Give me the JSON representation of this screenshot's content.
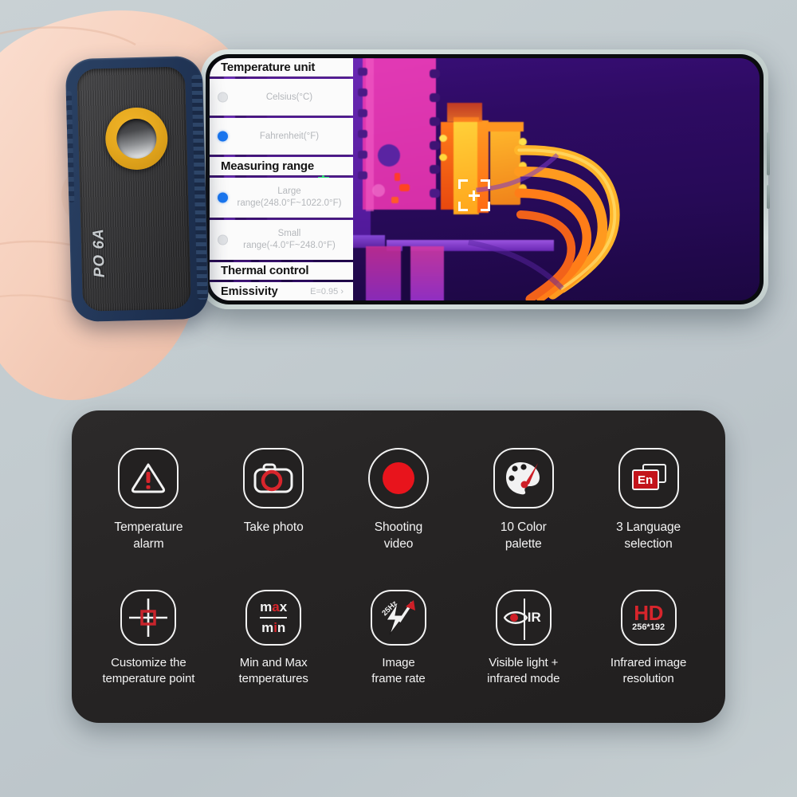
{
  "background_color": "#c5ced1",
  "device": {
    "name": "thermal-imaging-camera-module",
    "brand_text": "PO 6A",
    "case_color": "#24395a",
    "lens_ring_color": "#e5a81e"
  },
  "phone": {
    "name": "smartphone-with-thermal-app",
    "frame_color": "#c8d4d2"
  },
  "settings": {
    "rows": [
      {
        "type": "header",
        "label": "Temperature unit"
      },
      {
        "type": "option",
        "label": "Celsius(°C)",
        "selected": false
      },
      {
        "type": "option",
        "label": "Fahrenheit(°F)",
        "selected": true
      },
      {
        "type": "header",
        "label": "Measuring range"
      },
      {
        "type": "option",
        "label": "Large range(248.0°F~1022.0°F)",
        "selected": true
      },
      {
        "type": "option",
        "label": "Small range(-4.0°F~248.0°F)",
        "selected": false
      },
      {
        "type": "header",
        "label": "Thermal control"
      },
      {
        "type": "keyvalue",
        "label": "Emissivity",
        "value": "E=0.95 ›"
      }
    ],
    "selected_radio_color": "#1976f0",
    "unselected_radio_color": "#e2e4e7"
  },
  "thermal_view": {
    "reticles": [
      {
        "name": "cold-spot-reticle",
        "color": "#2fe07a"
      },
      {
        "name": "hot-spot-reticle",
        "color": "#ffffff"
      }
    ]
  },
  "features": {
    "panel_color": "#262424",
    "row1": [
      {
        "icon": "temperature-alarm-icon",
        "label": "Temperature\nalarm"
      },
      {
        "icon": "take-photo-camera-icon",
        "label": "Take photo"
      },
      {
        "icon": "shooting-video-record-icon",
        "label": "Shooting\nvideo"
      },
      {
        "icon": "color-palette-icon",
        "label": "10 Color\npalette"
      },
      {
        "icon": "language-selection-en-icon",
        "label": "3 Language\nselection"
      }
    ],
    "row2": [
      {
        "icon": "crosshair-temperature-point-icon",
        "label": "Customize the\ntemperature point"
      },
      {
        "icon": "min-max-temperature-icon",
        "label": "Min and Max\ntemperatures",
        "max_text": "max",
        "min_text": "min"
      },
      {
        "icon": "frame-rate-lightning-icon",
        "label": "Image\nframe rate",
        "rate_text": "25Hz"
      },
      {
        "icon": "visible-light-infrared-icon",
        "label": "Visible light +\ninfrared mode",
        "ir_text": "IR"
      },
      {
        "icon": "hd-resolution-icon",
        "label": "Infrared image\nresolution",
        "hd_text": "HD",
        "resolution_text": "256*192"
      }
    ]
  }
}
